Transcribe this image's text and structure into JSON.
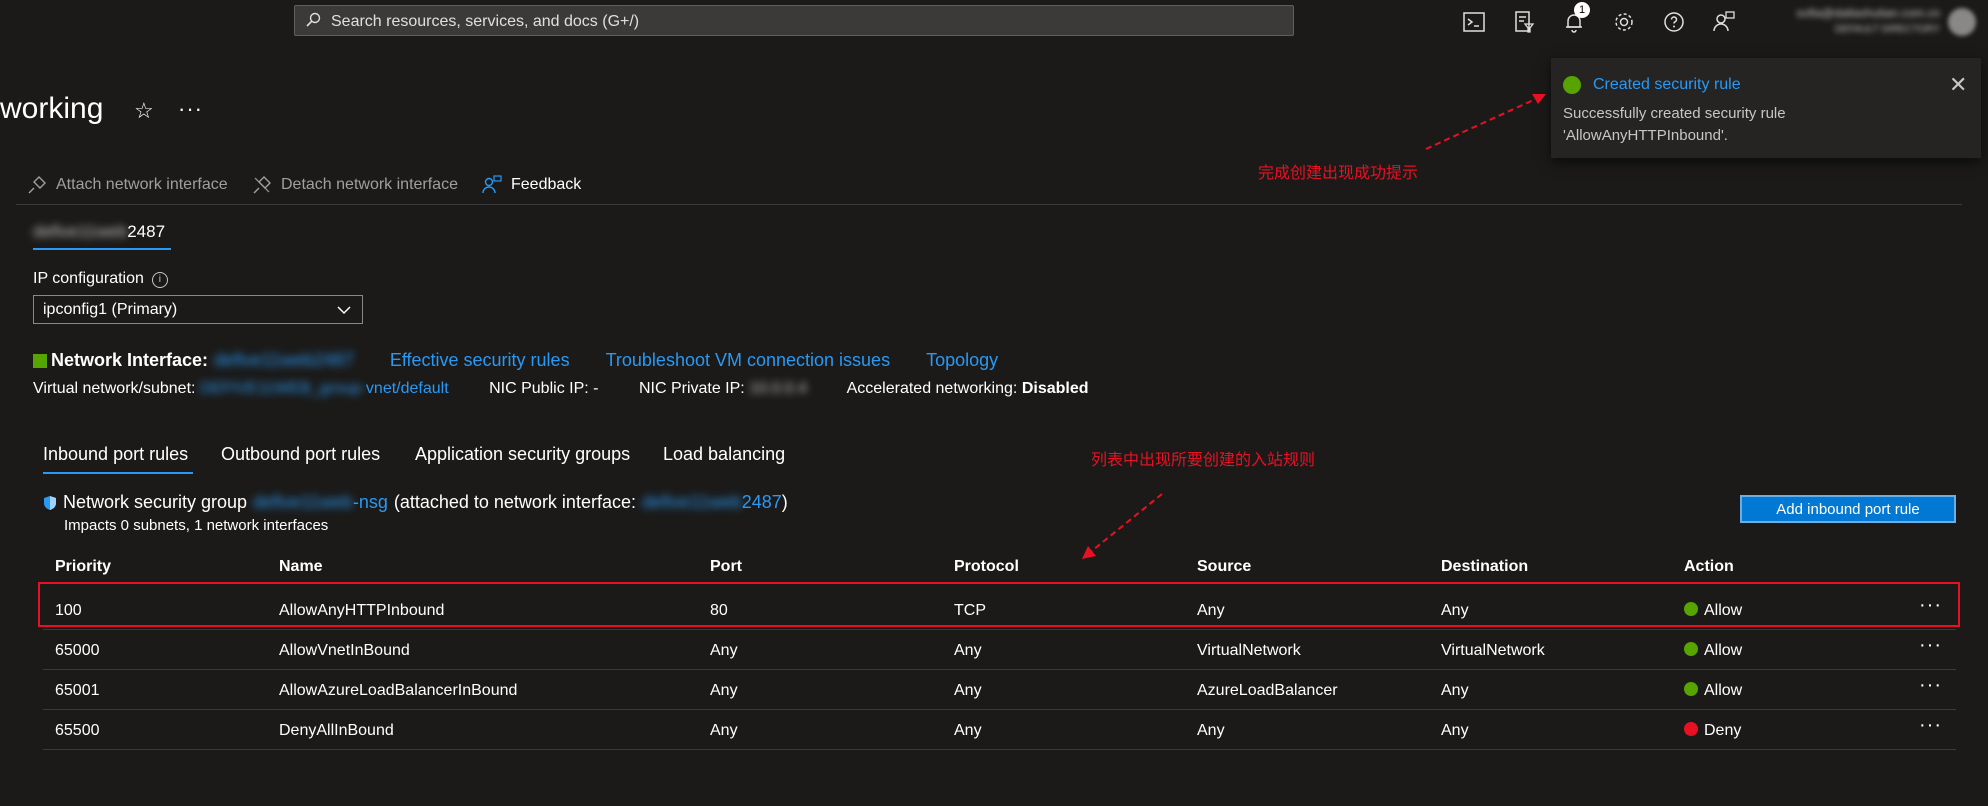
{
  "topbar": {
    "search_placeholder": "Search resources, services, and docs (G+/)",
    "notification_count": "1",
    "user_email": "sofia@dallashutian.com.cn",
    "user_tenant": "DEFAULT DIRECTORY"
  },
  "page": {
    "title": "working"
  },
  "toolbar": {
    "attach_label": "Attach network interface",
    "detach_label": "Detach network interface",
    "feedback_label": "Feedback"
  },
  "nic_tab": {
    "prefix": "defive11web",
    "suffix": "2487"
  },
  "ip_config": {
    "label": "IP configuration",
    "selected": "ipconfig1 (Primary)"
  },
  "network_interface": {
    "label": "Network Interface:",
    "name": "defive11web2487",
    "links": [
      "Effective security rules",
      "Troubleshoot VM connection issues",
      "Topology"
    ]
  },
  "vnet_info": {
    "vnet_label": "Virtual network/subnet:",
    "vnet_blur": "DEFIVE11WEB_group-",
    "vnet_value": "vnet/default",
    "public_ip_label": "NIC Public IP:",
    "public_ip_value": "-",
    "private_ip_label": "NIC Private IP:",
    "private_ip_value": "10.0.0.4",
    "accel_label": "Accelerated networking:",
    "accel_value": "Disabled"
  },
  "tabs": [
    "Inbound port rules",
    "Outbound port rules",
    "Application security groups",
    "Load balancing"
  ],
  "nsg": {
    "label": "Network security group",
    "name_blur": "defive11web",
    "name_suffix": "-nsg",
    "attached_text": "(attached to network interface:",
    "nic_blur": "defive11web",
    "nic_suffix": "2487",
    "close_paren": ")",
    "impacts": "Impacts 0 subnets, 1 network interfaces"
  },
  "add_button": "Add inbound port rule",
  "table": {
    "headers": [
      "Priority",
      "Name",
      "Port",
      "Protocol",
      "Source",
      "Destination",
      "Action"
    ],
    "rows": [
      {
        "priority": "100",
        "name": "AllowAnyHTTPInbound",
        "port": "80",
        "protocol": "TCP",
        "source": "Any",
        "destination": "Any",
        "action": "Allow"
      },
      {
        "priority": "65000",
        "name": "AllowVnetInBound",
        "port": "Any",
        "protocol": "Any",
        "source": "VirtualNetwork",
        "destination": "VirtualNetwork",
        "action": "Allow"
      },
      {
        "priority": "65001",
        "name": "AllowAzureLoadBalancerInBound",
        "port": "Any",
        "protocol": "Any",
        "source": "AzureLoadBalancer",
        "destination": "Any",
        "action": "Allow"
      },
      {
        "priority": "65500",
        "name": "DenyAllInBound",
        "port": "Any",
        "protocol": "Any",
        "source": "Any",
        "destination": "Any",
        "action": "Deny"
      }
    ]
  },
  "toast": {
    "title": "Created security rule",
    "message": "Successfully created security rule 'AllowAnyHTTPInbound'."
  },
  "annotations": {
    "toast_note": "完成创建出现成功提示",
    "table_note": "列表中出现所要创建的入站规则"
  },
  "colors": {
    "accent": "#2899f5",
    "allow": "#57a300",
    "deny": "#e81123",
    "annotation": "#e81123"
  }
}
